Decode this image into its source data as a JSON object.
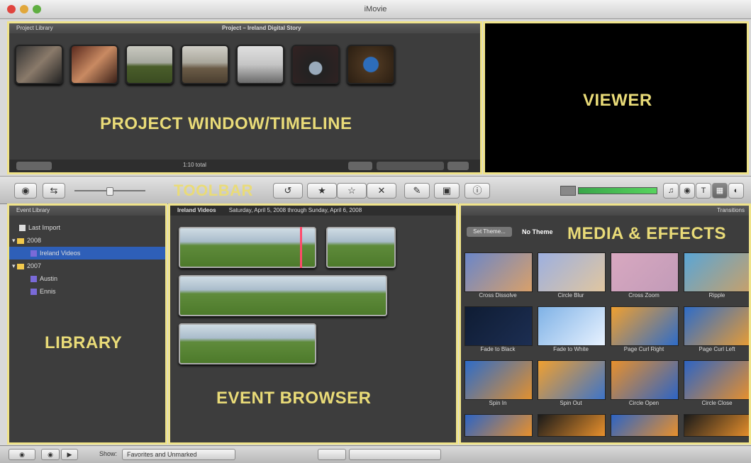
{
  "window": {
    "title": "iMovie"
  },
  "project": {
    "header_left": "Project Library",
    "header_center": "Project – Ireland Digital Story",
    "label": "PROJECT WINDOW/TIMELINE",
    "footer_text": "1:10 total"
  },
  "viewer": {
    "label": "VIEWER"
  },
  "toolbar": {
    "label": "TOOLBAR",
    "buttons": [
      "camera-icon",
      "swap-icon",
      "undo-icon",
      "star-icon",
      "empty-star-icon",
      "reject-icon",
      "voiceover-icon",
      "crop-icon",
      "info-icon"
    ],
    "right_buttons": [
      "music-icon",
      "photo-icon",
      "title-icon",
      "transition-icon",
      "map-icon"
    ]
  },
  "library": {
    "header": "Event Library",
    "label": "LIBRARY",
    "items": [
      {
        "text": "Last Import",
        "type": "import"
      },
      {
        "text": "2008",
        "type": "folder"
      },
      {
        "text": "Ireland Videos",
        "type": "event",
        "selected": true
      },
      {
        "text": "2007",
        "type": "folder"
      },
      {
        "text": "Austin",
        "type": "event"
      },
      {
        "text": "Ennis",
        "type": "event"
      }
    ]
  },
  "events": {
    "header_title": "Ireland Videos",
    "header_range": "Saturday, April 5, 2008 through Sunday, April 6, 2008",
    "label": "EVENT BROWSER"
  },
  "media": {
    "header": "Transitions",
    "theme_button": "Set Theme...",
    "theme_text": "No Theme",
    "label": "MEDIA & EFFECTS",
    "tiles": [
      {
        "caption": "Cross Dissolve",
        "c1": "#6a86c9",
        "c2": "#d8a06a"
      },
      {
        "caption": "Circle Blur",
        "c1": "#9db0e0",
        "c2": "#e0c6a0"
      },
      {
        "caption": "Cross Zoom",
        "c1": "#d8a8c0",
        "c2": "#c29bb8"
      },
      {
        "caption": "Ripple",
        "c1": "#5aa6d6",
        "c2": "#c7a06a"
      },
      {
        "caption": "Fade to Black",
        "c1": "#0f1c33",
        "c2": "#1c2e52"
      },
      {
        "caption": "Fade to White",
        "c1": "#7fb2e6",
        "c2": "#e8f2ff"
      },
      {
        "caption": "Page Curl Right",
        "c1": "#f0a030",
        "c2": "#2e6cc8"
      },
      {
        "caption": "Page Curl Left",
        "c1": "#2e6cc8",
        "c2": "#e89c34"
      },
      {
        "caption": "Spin In",
        "c1": "#2e6cc8",
        "c2": "#e09030"
      },
      {
        "caption": "Spin Out",
        "c1": "#f0a030",
        "c2": "#3d74c8"
      },
      {
        "caption": "Circle Open",
        "c1": "#e8902c",
        "c2": "#2d64c4"
      },
      {
        "caption": "Circle Close",
        "c1": "#2d64c4",
        "c2": "#e8902c"
      }
    ]
  },
  "bottombar": {
    "show_label": "Show:",
    "show_value": "Favorites and Unmarked"
  }
}
